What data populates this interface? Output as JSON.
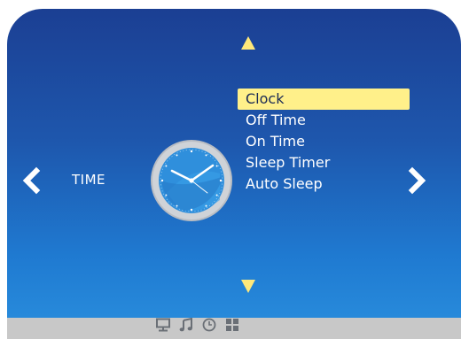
{
  "section": {
    "label": "TIME"
  },
  "menu": {
    "items": [
      {
        "label": "Clock",
        "selected": true
      },
      {
        "label": "Off Time",
        "selected": false
      },
      {
        "label": "On Time",
        "selected": false
      },
      {
        "label": "Sleep Timer",
        "selected": false
      },
      {
        "label": "Auto Sleep",
        "selected": false
      }
    ]
  },
  "icons": {
    "up": "up-arrow-icon",
    "down": "down-arrow-icon",
    "left": "chevron-left-icon",
    "right": "chevron-right-icon",
    "clock": "clock-icon",
    "dock": [
      "picture-icon",
      "sound-icon",
      "time-icon",
      "setup-icon"
    ]
  },
  "colors": {
    "highlight": "#fff08a",
    "arrow": "#ffe87a",
    "bottom_bar": "#c8c8c8"
  }
}
